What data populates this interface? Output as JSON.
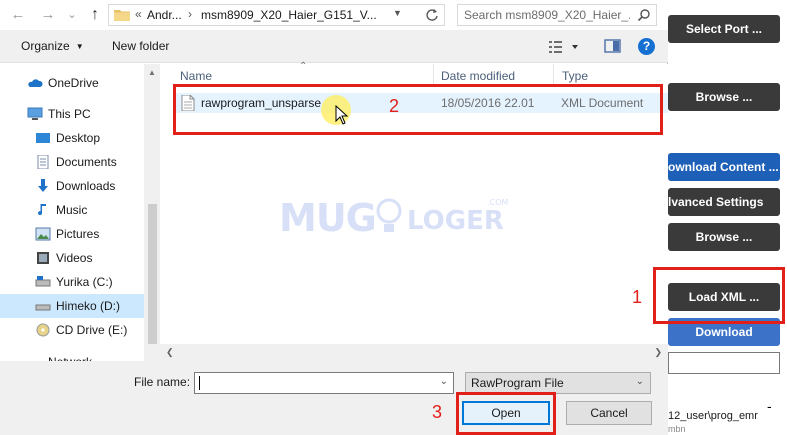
{
  "dialog": {
    "nav": {
      "back_glyph": "←",
      "forward_glyph": "→",
      "recent_glyph": "⌄",
      "up_glyph": "↑"
    },
    "address": {
      "prefix": "«",
      "crumbs": [
        "Andr...",
        "msm8909_X20_Haier_G151_V..."
      ],
      "separator": "›"
    },
    "search": {
      "placeholder": "Search msm8909_X20_Haier_..."
    },
    "toolbar": {
      "organize_label": "Organize",
      "new_folder_label": "New folder"
    },
    "sidebar": {
      "items": [
        {
          "label": "OneDrive",
          "icon": "cloud-icon"
        },
        {
          "label": "This PC",
          "icon": "computer-icon"
        },
        {
          "label": "Desktop",
          "icon": "desktop-icon"
        },
        {
          "label": "Documents",
          "icon": "documents-icon"
        },
        {
          "label": "Downloads",
          "icon": "downloads-icon"
        },
        {
          "label": "Music",
          "icon": "music-icon"
        },
        {
          "label": "Pictures",
          "icon": "pictures-icon"
        },
        {
          "label": "Videos",
          "icon": "videos-icon"
        },
        {
          "label": "Yurika (C:)",
          "icon": "drive-icon"
        },
        {
          "label": "Himeko (D:)",
          "icon": "drive-icon",
          "selected": true
        },
        {
          "label": "CD Drive (E:)",
          "icon": "cd-drive-icon"
        },
        {
          "label": "Network",
          "icon": "network-icon"
        }
      ]
    },
    "columns": {
      "name": "Name",
      "date_modified": "Date modified",
      "type": "Type"
    },
    "files": [
      {
        "name": "rawprogram_unsparse",
        "date_modified": "18/05/2016 22.01",
        "type": "XML Document"
      }
    ],
    "file_name_label": "File name:",
    "file_name_value": "",
    "file_type_filter": "RawProgram File",
    "open_label": "Open",
    "cancel_label": "Cancel"
  },
  "app": {
    "buttons": [
      "Select Port ...",
      "Browse ...",
      "ownload Content ...",
      "lvanced Settings",
      "Browse ...",
      "Load XML ...",
      "Download"
    ],
    "path_text": "12_user\\prog_emr",
    "path_text_2": "mbn",
    "dash": "-"
  },
  "annotations": {
    "step1": "1",
    "step2": "2",
    "step3": "3"
  },
  "watermark": {
    "part1": "MUG",
    "part2": "LOGER",
    "part3": ".COM"
  },
  "colors": {
    "annotation_red": "#e2201a",
    "selection_blue": "#cce8ff",
    "accent_blue": "#0078d7"
  }
}
